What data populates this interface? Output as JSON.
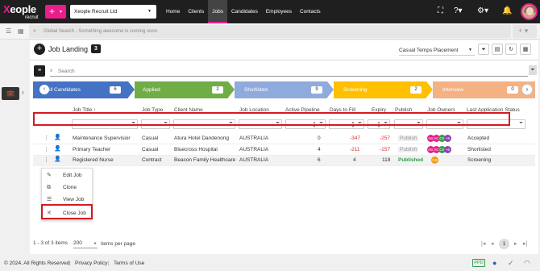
{
  "brand": {
    "logo_text": "Xeople",
    "logo_sub": "recruit"
  },
  "topbar": {
    "company": "Xeople Recruit Ltd",
    "nav": [
      "Home",
      "Clients",
      "Jobs",
      "Candidates",
      "Employees",
      "Contacts"
    ],
    "active_nav": "Jobs",
    "icons": [
      "fullscreen-icon",
      "help-icon",
      "settings-icon",
      "bell-icon",
      "user-avatar"
    ]
  },
  "search": {
    "placeholder": "Global Search - Something awesome is coming soon"
  },
  "page": {
    "title": "Job Landing",
    "count": "3",
    "view": "Casual Temps Placement",
    "search_placeholder": "Search"
  },
  "pipeline": [
    {
      "label": "All Candidates",
      "count": "6",
      "color": "#4472c4"
    },
    {
      "label": "Applied",
      "count": "2",
      "color": "#70ad47"
    },
    {
      "label": "Shorlisted",
      "count": "9",
      "color": "#8faadc"
    },
    {
      "label": "Screening",
      "count": "2",
      "color": "#ffc000"
    },
    {
      "label": "Interview",
      "count": "0",
      "color": "#f4b183"
    }
  ],
  "table": {
    "columns": [
      "Job Title",
      "Job Type",
      "Client Name",
      "Job Location",
      "Active Pipeline",
      "Days to Fill",
      "Expiry",
      "Publish",
      "Job Owners",
      "Last Application Status"
    ],
    "sort_indicator": "↑",
    "rows": [
      {
        "title": "Maintenance Supervisior",
        "type": "Casual",
        "client": "Atura Hotel Dandenong",
        "location": "AUSTRALIA",
        "pipeline": "0",
        "days": "-347",
        "expiry": "-257",
        "publish": "Publish",
        "owners": [
          "AM",
          "AC",
          "CS",
          "+6"
        ],
        "status": "Accepted"
      },
      {
        "title": "Primary Teacher",
        "type": "Casual",
        "client": "Bluecross Hospital",
        "location": "AUSTRALIA",
        "pipeline": "4",
        "days": "-211",
        "expiry": "-157",
        "publish": "Publish",
        "owners": [
          "AM",
          "AC",
          "CS",
          "+6"
        ],
        "status": "Shorlisted"
      },
      {
        "title": "Registered Nurse",
        "type": "Contract",
        "client": "Beacon Family Healthcare",
        "location": "AUSTRALIA",
        "pipeline": "6",
        "days": "4",
        "expiry": "118",
        "publish": "Published",
        "owners": [
          "CS"
        ],
        "status": "Screening"
      }
    ]
  },
  "context_menu": [
    "Edit Job",
    "Clone",
    "View Job",
    "Close Job"
  ],
  "pagination": {
    "summary": "1 - 3 of 3 items",
    "page_size": "200",
    "page_size_label": "items per page",
    "current": "1"
  },
  "footer": {
    "copyright": "© 2024. All Rights Reserved",
    "privacy": "Privacy Policy",
    "terms": "Terms of Use",
    "badge": "PPD"
  }
}
